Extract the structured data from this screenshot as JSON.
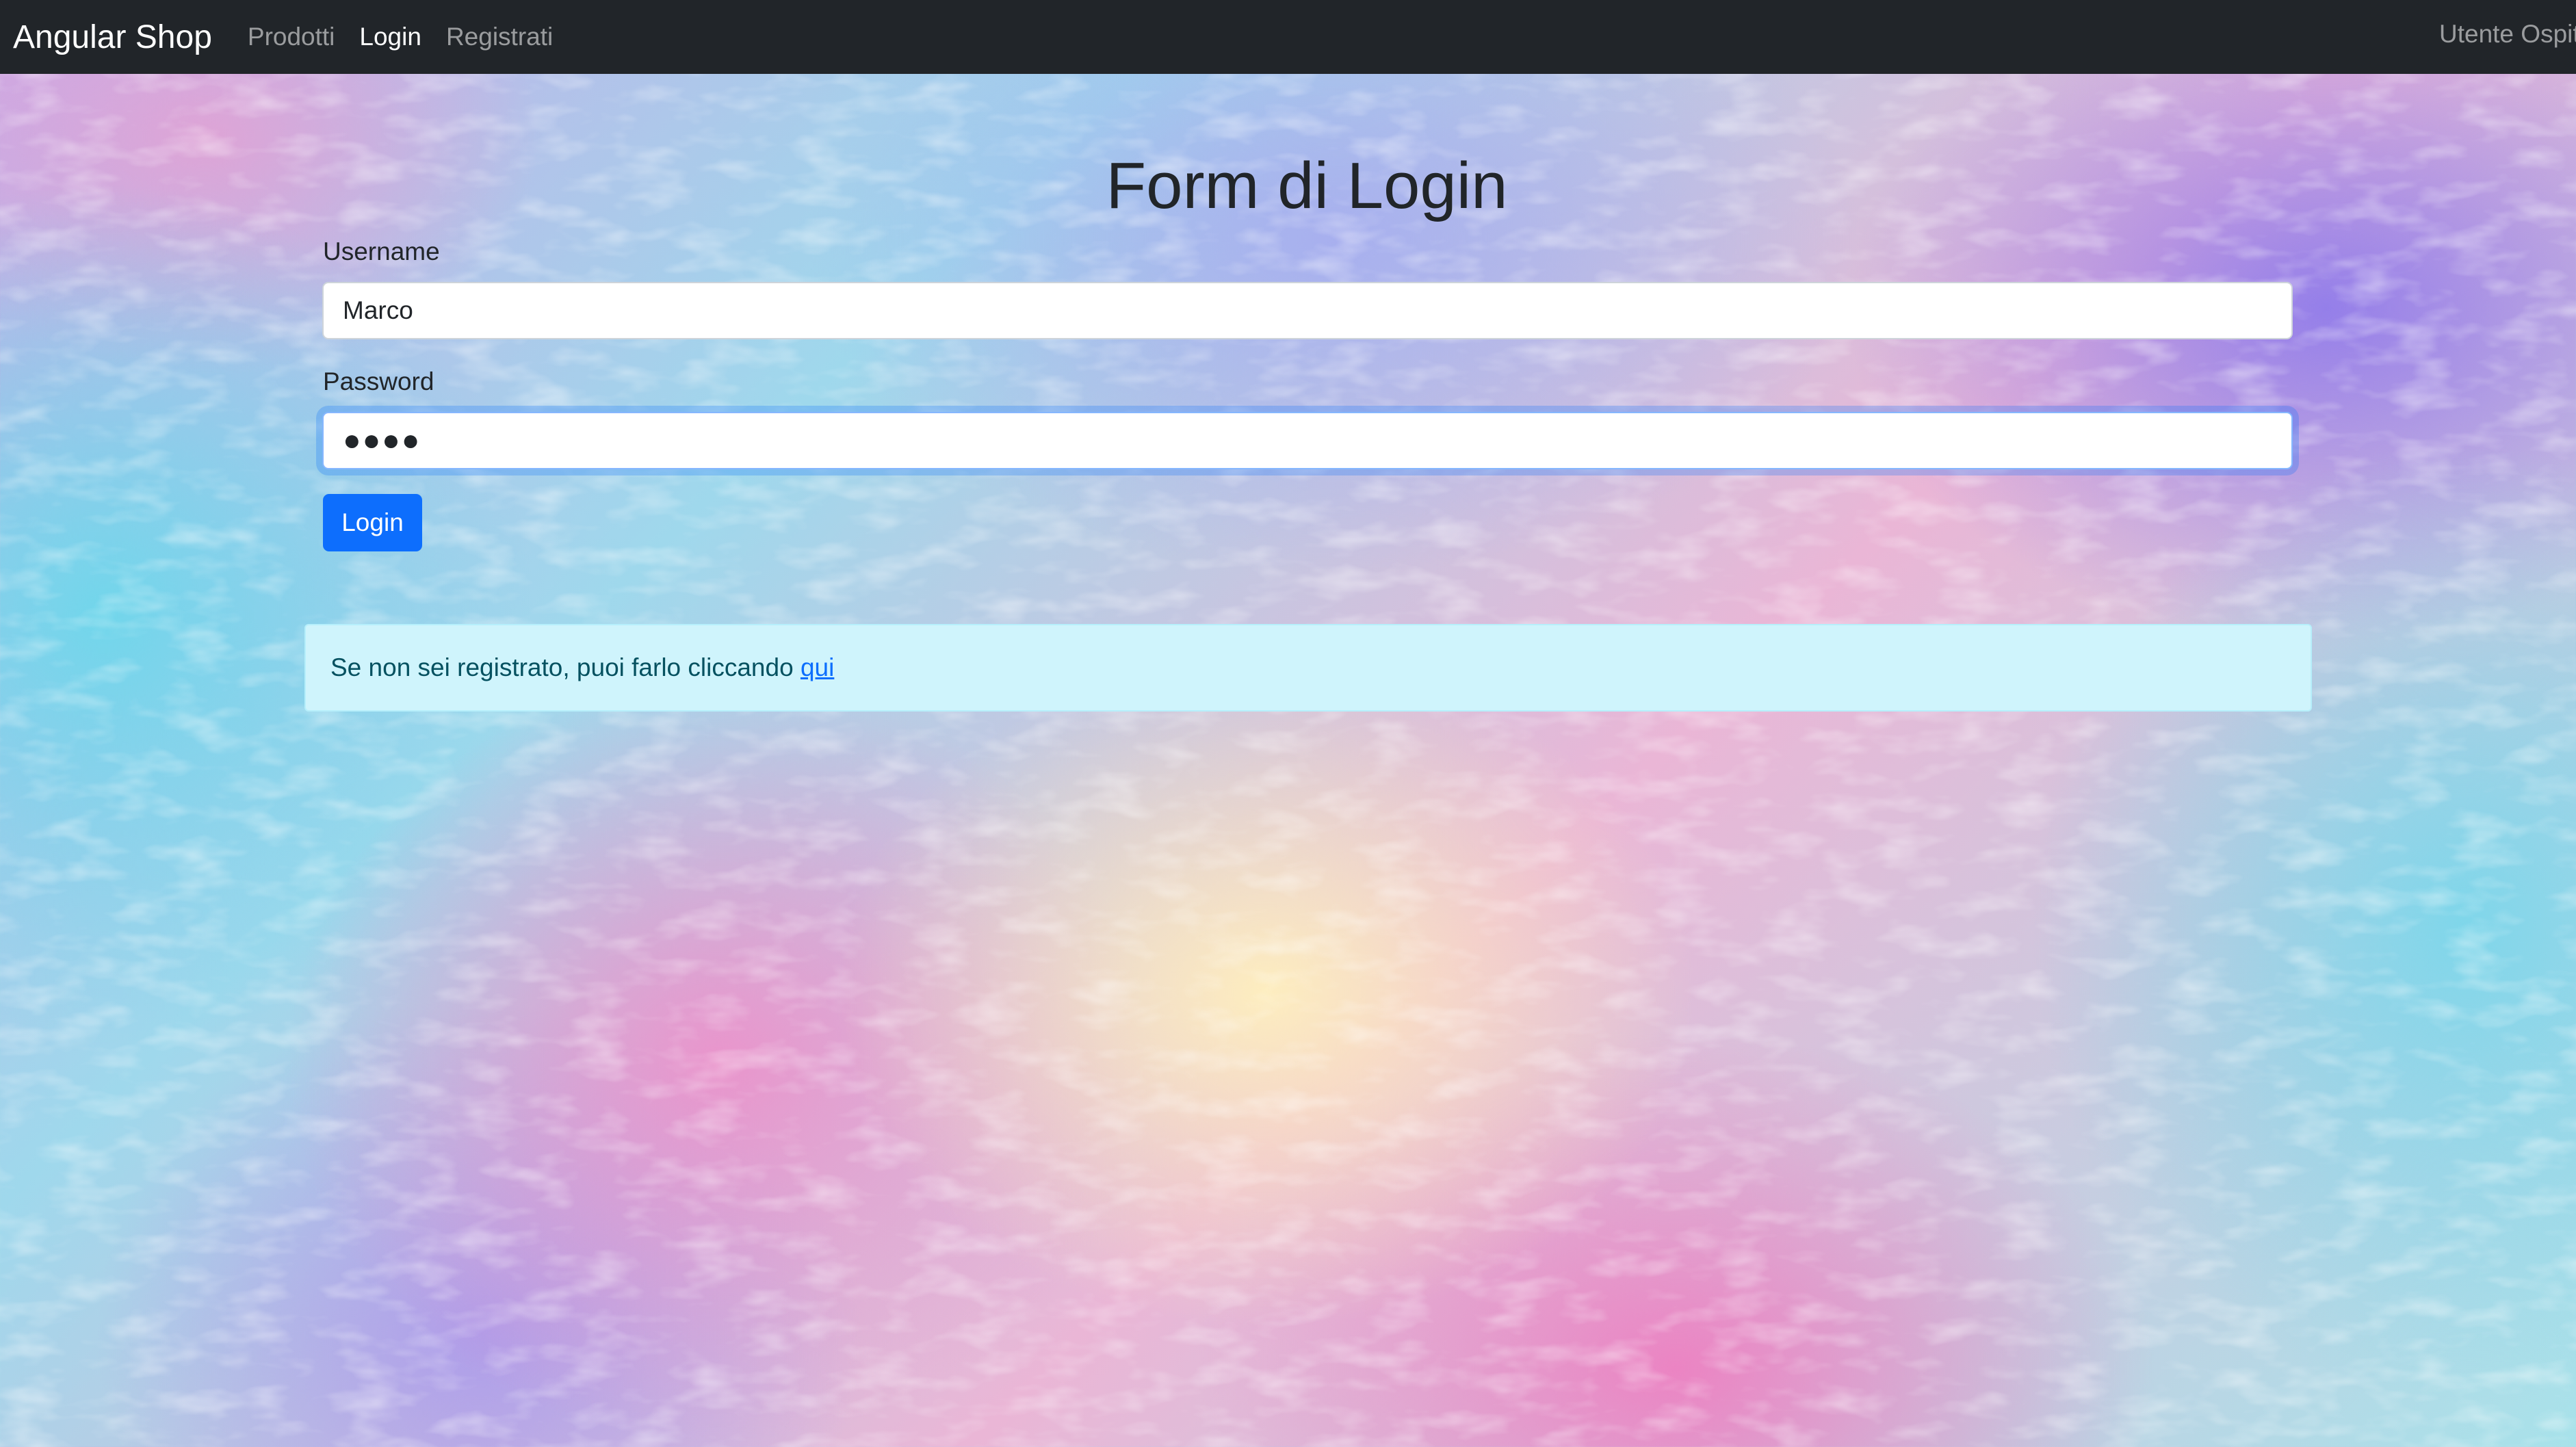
{
  "navbar": {
    "brand": "Angular Shop",
    "links": [
      {
        "label": "Prodotti",
        "active": false
      },
      {
        "label": "Login",
        "active": true
      },
      {
        "label": "Registrati",
        "active": false
      }
    ],
    "user": "Utente Ospite"
  },
  "form": {
    "title": "Form di Login",
    "username_label": "Username",
    "username_value": "Marco",
    "password_label": "Password",
    "password_masked": "●●●●",
    "submit_label": "Login"
  },
  "alert": {
    "text": "Se non sei registrato, puoi farlo cliccando ",
    "link": "qui"
  },
  "colors": {
    "navbar_bg": "#212529",
    "primary": "#0d6efd",
    "alert_bg": "#cff4fc",
    "alert_text": "#055160"
  }
}
